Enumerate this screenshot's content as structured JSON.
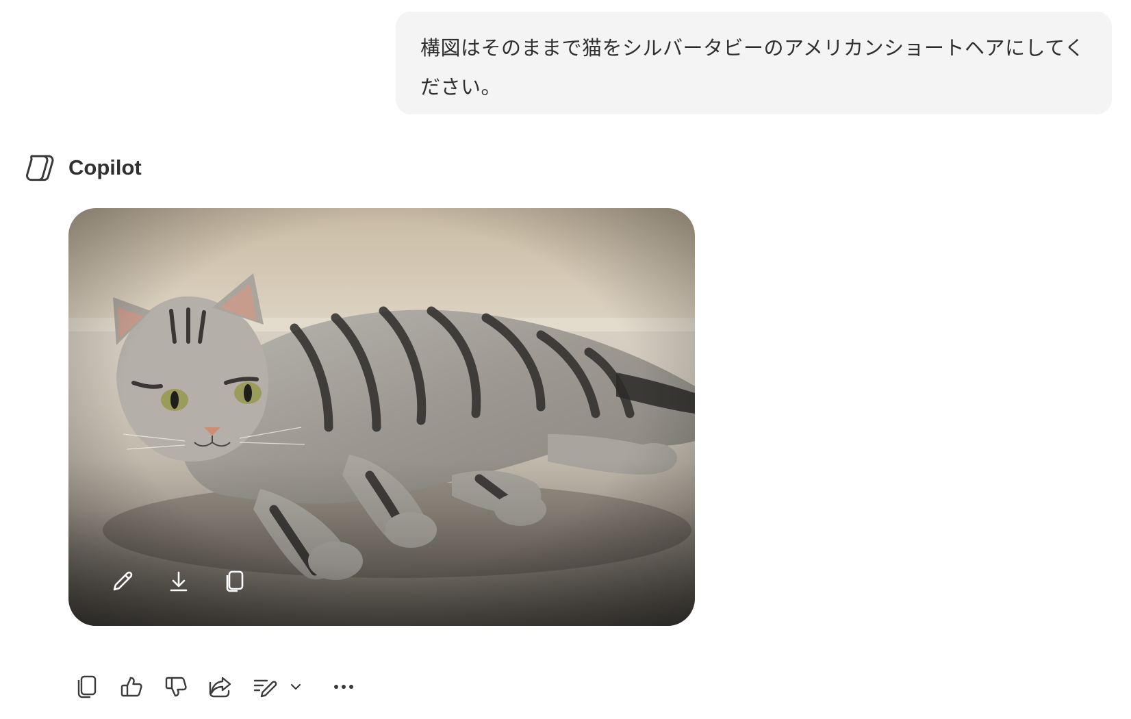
{
  "user_message": {
    "text": "構図はそのままで猫をシルバータビーのアメリカンショートヘアにしてください。"
  },
  "assistant": {
    "name": "Copilot",
    "logo_icon": "copilot-logo-icon"
  },
  "generated_image": {
    "subject": "silver tabby American Shorthair cat lying on carpet",
    "tools": [
      "pencil-edit-icon",
      "download-icon",
      "copy-icon"
    ]
  },
  "message_actions": [
    "copy-icon",
    "thumbs-up-icon",
    "thumbs-down-icon",
    "share-icon",
    "edit-pen-icon",
    "chevron-down-icon",
    "more-options-icon"
  ],
  "colors": {
    "user_bubble_bg": "#f4f4f4",
    "text": "#2f2f2f",
    "icon": "#3a3a3a"
  }
}
